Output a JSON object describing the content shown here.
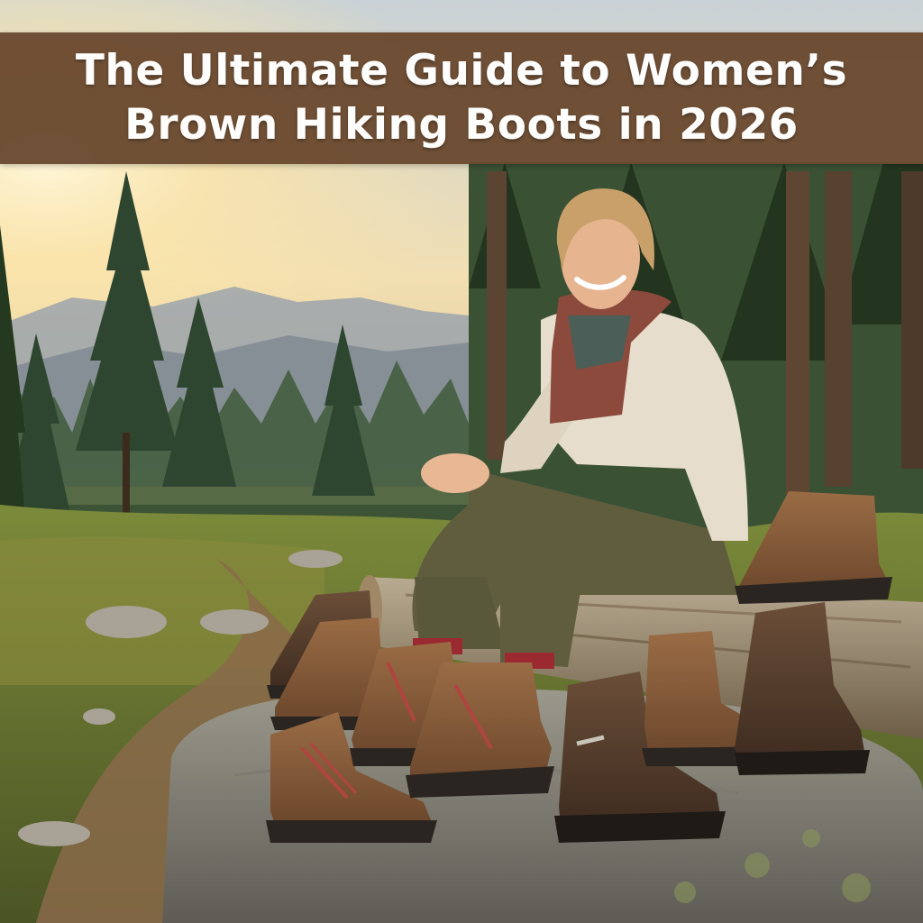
{
  "title": {
    "line1": "The Ultimate Guide to Women’s",
    "line2": "Brown Hiking Boots in 2026"
  },
  "colors": {
    "banner": "#6b4a30",
    "title_text": "#ffffff",
    "boot_brown": "#7a5236",
    "boot_dark": "#4a3526",
    "sweater": "#e6ddcc",
    "pants": "#5d5a3c",
    "rock": "#8a877c"
  },
  "scene": {
    "subject": "woman-sitting-on-log",
    "boot_count": 9
  }
}
